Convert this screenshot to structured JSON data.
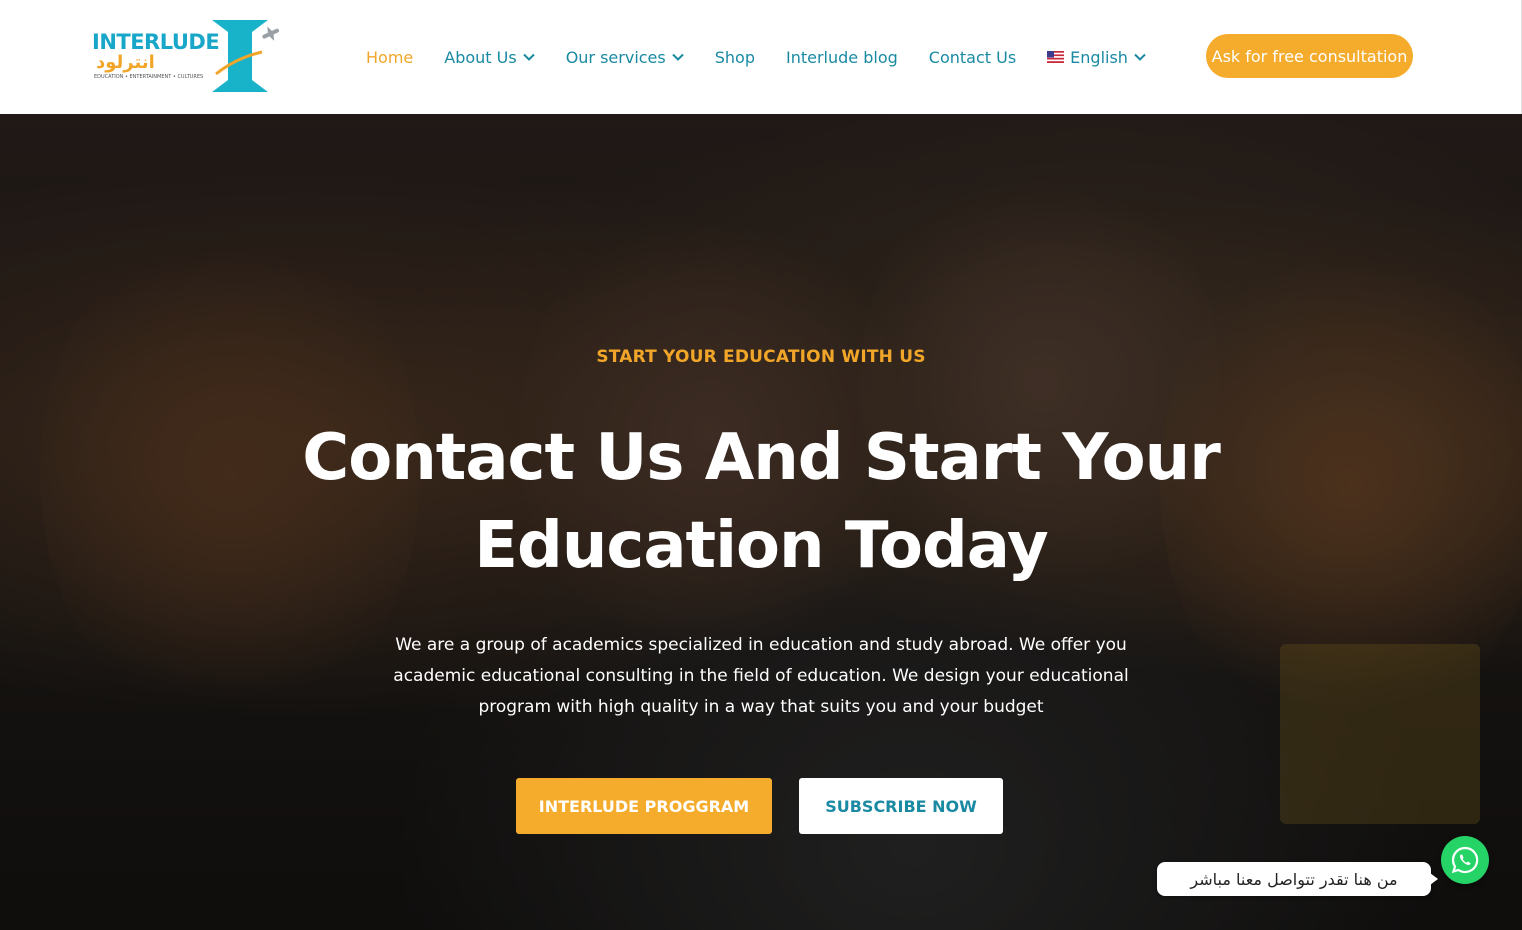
{
  "brand": {
    "name_en": "INTERLUDE",
    "name_ar": "انترلود",
    "tagline": "EDUCATION • ENTERTAINMENT • CULTURES",
    "primary_color": "#f2a629",
    "secondary_color": "#1a8aa3"
  },
  "nav": {
    "items": [
      {
        "label": "Home",
        "active": true
      },
      {
        "label": "About Us",
        "dropdown": true
      },
      {
        "label": "Our services",
        "dropdown": true
      },
      {
        "label": "Shop"
      },
      {
        "label": "Interlude blog"
      },
      {
        "label": "Contact Us"
      },
      {
        "label": "English",
        "dropdown": true,
        "icon": "us-flag-icon"
      }
    ],
    "cta_label": "Ask for free consultation"
  },
  "hero": {
    "eyebrow": "START YOUR EDUCATION WITH US",
    "headline": "Contact Us And Start Your Education Today",
    "description": "We are a group of academics specialized in education and study abroad. We offer you academic educational consulting in the field of education. We design your educational program with high quality in a way that suits you and your budget",
    "primary_button": "INTERLUDE PROGGRAM",
    "secondary_button": "SUBSCRIBE NOW"
  },
  "whatsapp": {
    "bubble_text": "من هنا تقدر تتواصل معنا مباشر",
    "icon": "whatsapp-icon",
    "color": "#25d366"
  }
}
